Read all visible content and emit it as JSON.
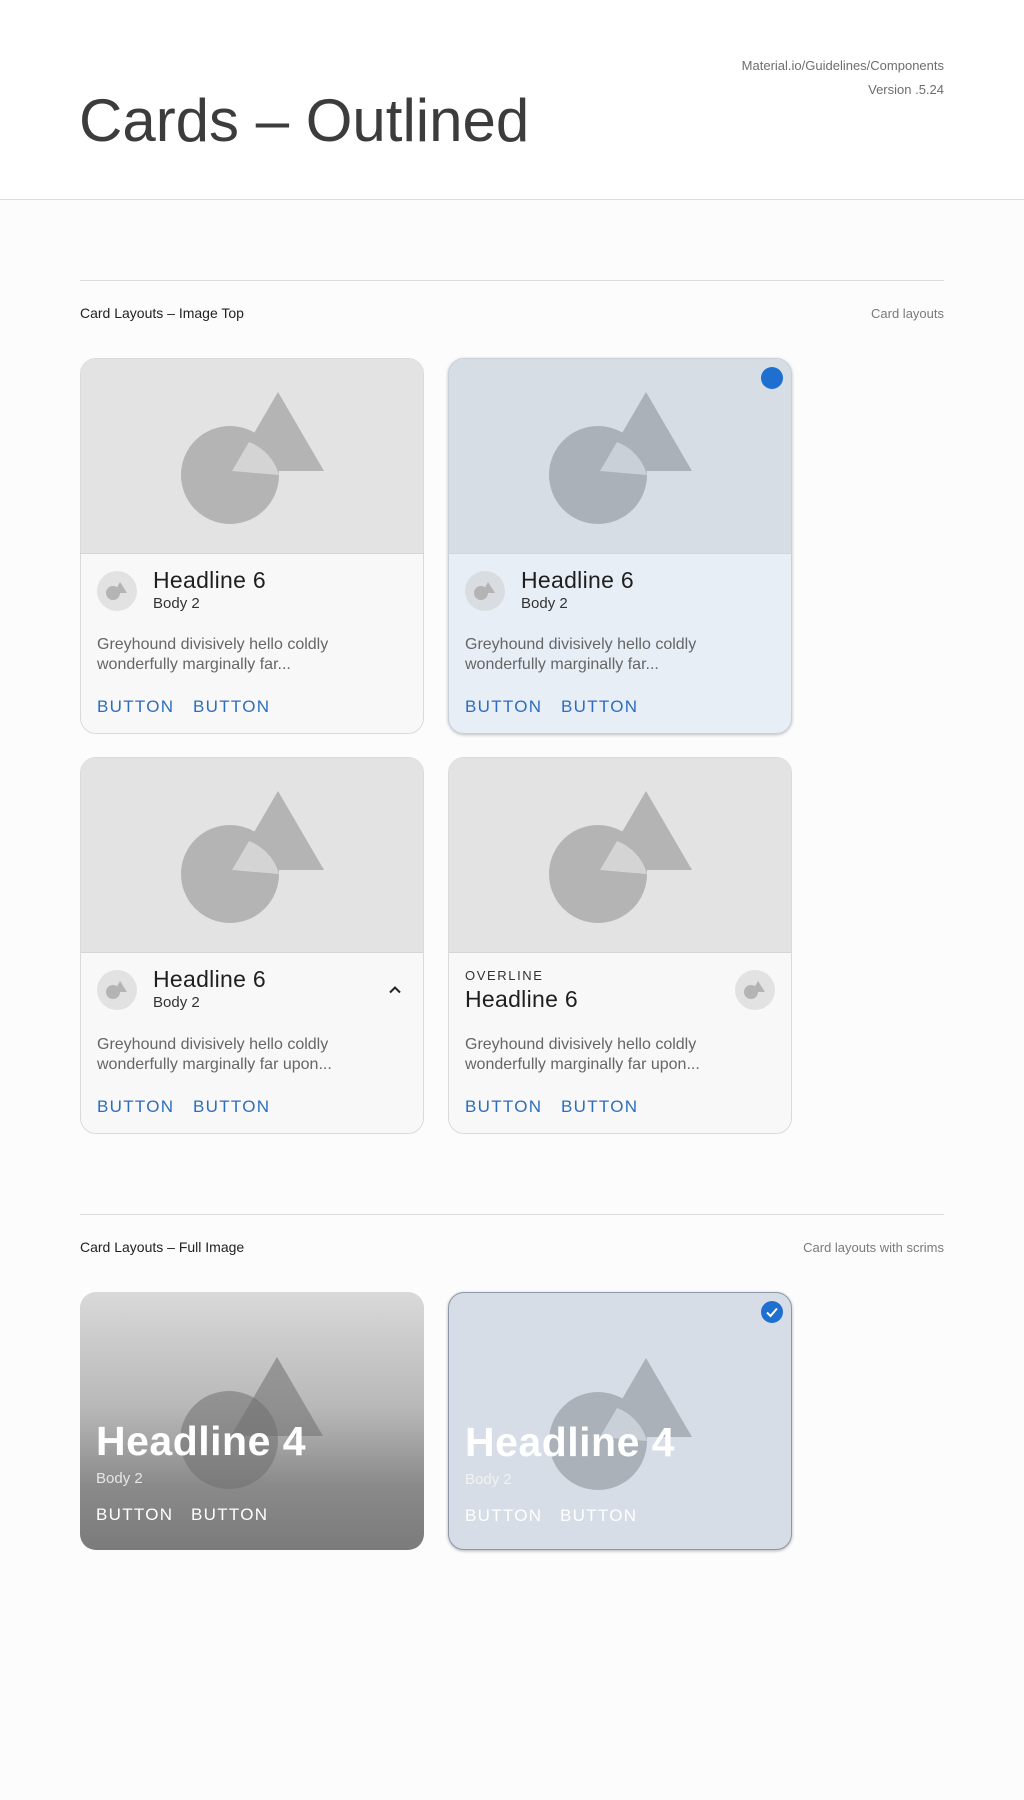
{
  "header": {
    "title": "Cards – Outlined",
    "meta_line1": "Material.io/Guidelines/Components",
    "meta_line2": "Version .5.24"
  },
  "sections": [
    {
      "title": "Card Layouts – Image Top",
      "subtitle": "Card layouts"
    },
    {
      "title": "Card Layouts – Full Image",
      "subtitle": "Card layouts with scrims"
    }
  ],
  "cards": [
    {
      "headline": "Headline 6",
      "body": "Body 2",
      "text": "Greyhound divisively hello coldly wonderfully marginally far...",
      "button1": "BUTTON",
      "button2": "BUTTON"
    },
    {
      "headline": "Headline 6",
      "body": "Body 2",
      "text": "Greyhound divisively hello coldly wonderfully marginally far...",
      "button1": "BUTTON",
      "button2": "BUTTON"
    },
    {
      "headline": "Headline 6",
      "body": "Body 2",
      "text": "Greyhound divisively hello coldly wonderfully marginally far upon...",
      "button1": "BUTTON",
      "button2": "BUTTON"
    },
    {
      "overline": "OVERLINE",
      "headline": "Headline 6",
      "text": "Greyhound divisively hello coldly wonderfully marginally far upon...",
      "button1": "BUTTON",
      "button2": "BUTTON"
    }
  ],
  "full_cards": [
    {
      "headline": "Headline 4",
      "body": "Body 2",
      "button1": "BUTTON",
      "button2": "BUTTON"
    },
    {
      "headline": "Headline 4",
      "body": "Body 2",
      "button1": "BUTTON",
      "button2": "BUTTON"
    }
  ],
  "colors": {
    "accent": "#2d6dbf",
    "check": "#1e6fcf",
    "placeholder": "#b4b4b4"
  },
  "icons": {
    "media": "shapes-icon",
    "selected": "check-circle-icon",
    "expand": "chevron-up-icon"
  }
}
